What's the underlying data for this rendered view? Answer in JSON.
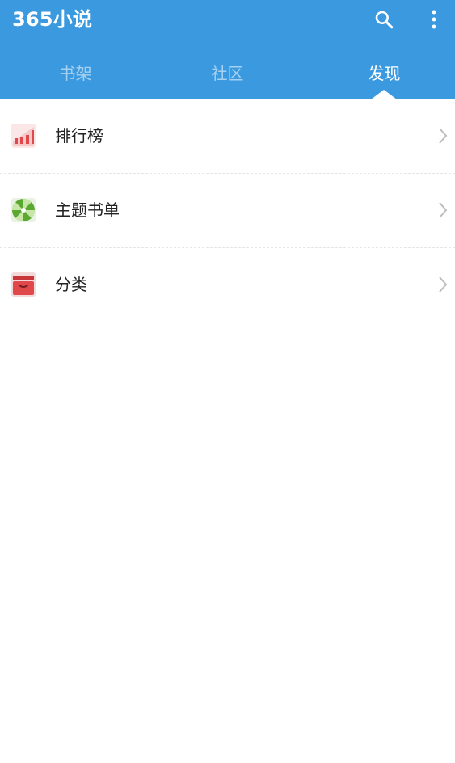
{
  "app": {
    "title": "365小说"
  },
  "toolbar": {
    "search_icon": "search-icon",
    "more_icon": "more-vert-icon"
  },
  "tabs": [
    {
      "label": "书架",
      "active": false
    },
    {
      "label": "社区",
      "active": false
    },
    {
      "label": "发现",
      "active": true
    }
  ],
  "discover": {
    "items": [
      {
        "label": "排行榜",
        "icon": "ranking-chart-icon"
      },
      {
        "label": "主题书单",
        "icon": "theme-booklist-icon"
      },
      {
        "label": "分类",
        "icon": "category-box-icon"
      }
    ]
  },
  "colors": {
    "primary": "#3b99df",
    "text": "#222222",
    "tab_inactive": "rgba(255,255,255,0.55)",
    "divider": "#e6e6e6",
    "chevron": "#bdbdbd"
  }
}
